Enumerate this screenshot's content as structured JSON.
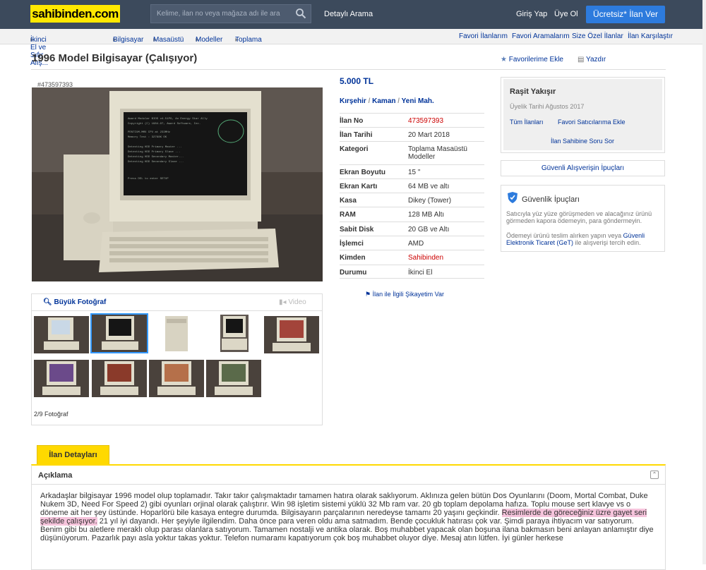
{
  "header": {
    "logo": "sahibinden.com",
    "search_placeholder": "Kelime, ilan no veya mağaza adı ile ara",
    "detayli": "Detaylı Arama",
    "giris": "Giriş Yap",
    "uye": "Üye Ol",
    "ilan_ver": "Ücretsiz* İlan Ver"
  },
  "breadcrumb": [
    "İkinci El ve Sıfır Alış...",
    "Bilgisayar",
    "Masaüstü",
    "Modeller",
    "Toplama"
  ],
  "subnav_right": [
    "Favori İlanlarım",
    "Favori Aramalarım",
    "Size Özel İlanlar",
    "İlan Karşılaştır"
  ],
  "title": "1996 Model Bilgisayar (Çalışıyor)",
  "actions": {
    "favorite": "Favorilerime Ekle",
    "print": "Yazdır"
  },
  "image_id": "#473597393",
  "gallery": {
    "big_photo": "Büyük Fotoğraf",
    "video": "Video",
    "counter": "2/9 Fotoğraf"
  },
  "price": "5.000 TL",
  "location": [
    "Kırşehir",
    "Kaman",
    "Yeni Mah."
  ],
  "details": [
    {
      "k": "İlan No",
      "v": "473597393"
    },
    {
      "k": "İlan Tarihi",
      "v": "20 Mart 2018"
    },
    {
      "k": "Kategori",
      "v": "Toplama Masaüstü Modeller"
    },
    {
      "k": "Ekran Boyutu",
      "v": "15 \""
    },
    {
      "k": "Ekran Kartı",
      "v": "64 MB ve altı"
    },
    {
      "k": "Kasa",
      "v": "Dikey (Tower)"
    },
    {
      "k": "RAM",
      "v": "128 MB Altı"
    },
    {
      "k": "Sabit Disk",
      "v": "20 GB ve Altı"
    },
    {
      "k": "İşlemci",
      "v": "AMD"
    },
    {
      "k": "Kimden",
      "v": "Sahibinden"
    },
    {
      "k": "Durumu",
      "v": "İkinci El"
    }
  ],
  "complaint": "İlan ile İlgili Şikayetim Var",
  "seller": {
    "name": "Raşit Yakışır",
    "since": "Üyelik Tarihi  Ağustos 2017",
    "all": "Tüm İlanları",
    "fav": "Favori Satıcılarıma Ekle",
    "ask": "İlan Sahibine Soru Sor"
  },
  "tips_button": "Güvenli Alışverişin İpuçları",
  "tips": {
    "title": "Güvenlik İpuçları",
    "p1": "Satıcıyla yüz yüze görüşmeden ve alacağınız ürünü görmeden kapora ödemeyin, para göndermeyin.",
    "p2a": "Ödemeyi ürünü teslim alırken yapın veya ",
    "p2link": "Güvenli Elektronik Ticaret (GeT)",
    "p2b": " ile alışverişi tercih edin."
  },
  "tab": "İlan Detayları",
  "description": {
    "title": "Açıklama",
    "before": "Arkadaşlar bilgisayar 1996 model olup toplamadır. Takır takır çalışmaktadır tamamen hatıra olarak saklıyorum. Aklınıza gelen bütün Dos Oyunlarını (Doom, Mortal Combat, Duke Nukem 3D, Need For Speed 2) gibi oyunları orjinal olarak çalıştırır. Win 98 işletim sistemi yüklü 32 Mb ram var. 20 gb toplam depolama hafıza.  Toplu mouse sert klavye vs o döneme ait her şey üstünde. Hoparlörü bile kasaya entegre durumda. Bilgisayarın parçalarının neredeyse tamamı 20 yaşını geçkindir. ",
    "highlight": "Resimlerde de göreceğiniz üzre gayet seri şekilde çalışıyor.",
    "after": " 21 yıl iyi dayandı. Her şeyiyle ilgilendim. Daha önce para veren oldu ama satmadım. Bende çocukluk hatırası çok var. Şimdi paraya ihtiyacım var satıyorum. Benim gibi bu aletlere meraklı olup parası olanlara satıyorum. Tamamen nostalji ve antika olarak. Boş muhabbet yapacak olan boşuna ilana bakmasın beni anlayan anlamıştır diye düşünüyorum. Pazarlık payı asla yoktur takas yoktur. Telefon numaramı kapatıyorum çok boş muhabbet oluyor diye. Mesaj atın lütfen. İyi günler herkese"
  },
  "colors": {
    "topbar": "#3c4a5c",
    "brand_yellow": "#ffe800",
    "link_blue": "#003399",
    "button_blue": "#2d7bdd",
    "red": "#cc0000"
  }
}
